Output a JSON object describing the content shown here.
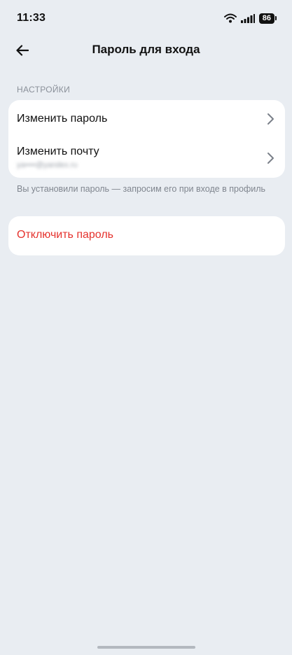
{
  "status_bar": {
    "time": "11:33",
    "battery": "86",
    "icons": [
      "wifi-icon",
      "signal-icon",
      "battery-icon"
    ]
  },
  "header": {
    "title": "Пароль для входа",
    "back_icon": "arrow-left-icon"
  },
  "settings": {
    "section_label": "НАСТРОЙКИ",
    "items": [
      {
        "label": "Изменить пароль",
        "icon": "chevron-right-icon"
      },
      {
        "label": "Изменить почту",
        "sublabel": "ya••••@yandex.ru",
        "icon": "chevron-right-icon"
      }
    ],
    "hint": "Вы установили пароль — запросим его при входе в профиль"
  },
  "disable": {
    "label": "Отключить пароль",
    "color": "#e5322d"
  }
}
